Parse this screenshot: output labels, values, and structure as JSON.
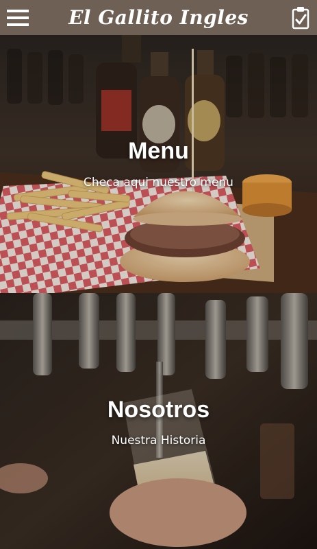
{
  "header": {
    "title": "El Gallito Ingles",
    "menu_icon": "hamburger-menu-icon",
    "clipboard_icon": "clipboard-check-icon"
  },
  "sections": [
    {
      "title": "Menu",
      "subtitle": "Checa aqui nuestro menu"
    },
    {
      "title": "Nosotros",
      "subtitle": "Nuestra Historia"
    }
  ],
  "colors": {
    "header_bg": "#6f6055",
    "text": "#ffffff"
  }
}
